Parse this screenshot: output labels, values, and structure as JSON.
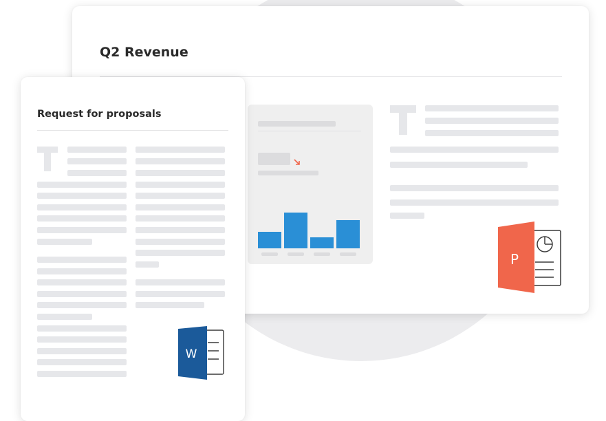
{
  "slide": {
    "title": "Q2 Revenue"
  },
  "document": {
    "title": "Request for proposals"
  },
  "powerpoint_icon": {
    "letter": "P",
    "color": "#f0664b",
    "name": "powerpoint-icon"
  },
  "word_icon": {
    "letter": "W",
    "color": "#1b5a9a",
    "name": "word-icon"
  },
  "mini_chart": {
    "accent": "#2a8fd6",
    "trend_color": "#f0664b",
    "trend": "down"
  }
}
